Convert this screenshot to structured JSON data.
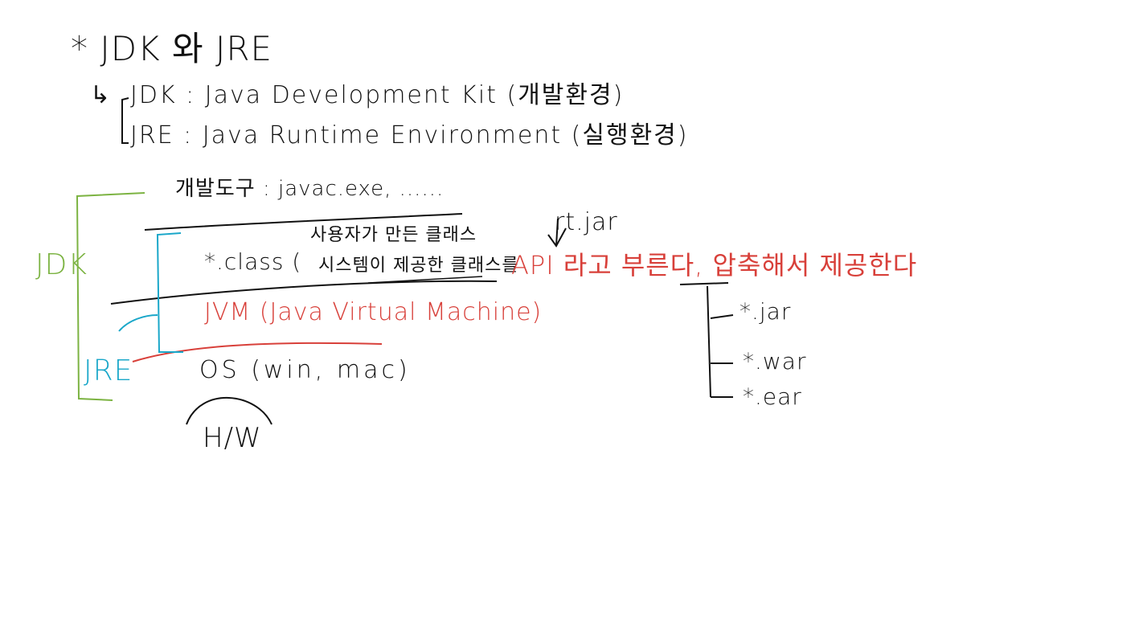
{
  "title": "* JDK 와 JRE",
  "definitions": {
    "arrow": "↳",
    "jdk": "JDK : Java Development Kit (개발환경)",
    "jre": "JRE : Java Runtime Environment (실행환경)"
  },
  "layers": {
    "dev_tools": "개발도구 : javac.exe, ......",
    "class_label": "*.class (",
    "class_user": "사용자가 만든 클래스",
    "class_system": "시스템이 제공한 클래스를",
    "api_note": "API 라고 부른다, 압축해서 제공한다",
    "rt_jar": "rt.jar",
    "jvm": "JVM (Java Virtual Machine)",
    "os": "OS (win, mac)",
    "hw": "H/W"
  },
  "brackets": {
    "jdk": "JDK",
    "jre": "JRE"
  },
  "archives": [
    "*.jar",
    "*.war",
    "*.ear"
  ],
  "colors": {
    "ink": "#111111",
    "red": "#d8403a",
    "green": "#7cb342",
    "cyan": "#1aa7c9"
  }
}
